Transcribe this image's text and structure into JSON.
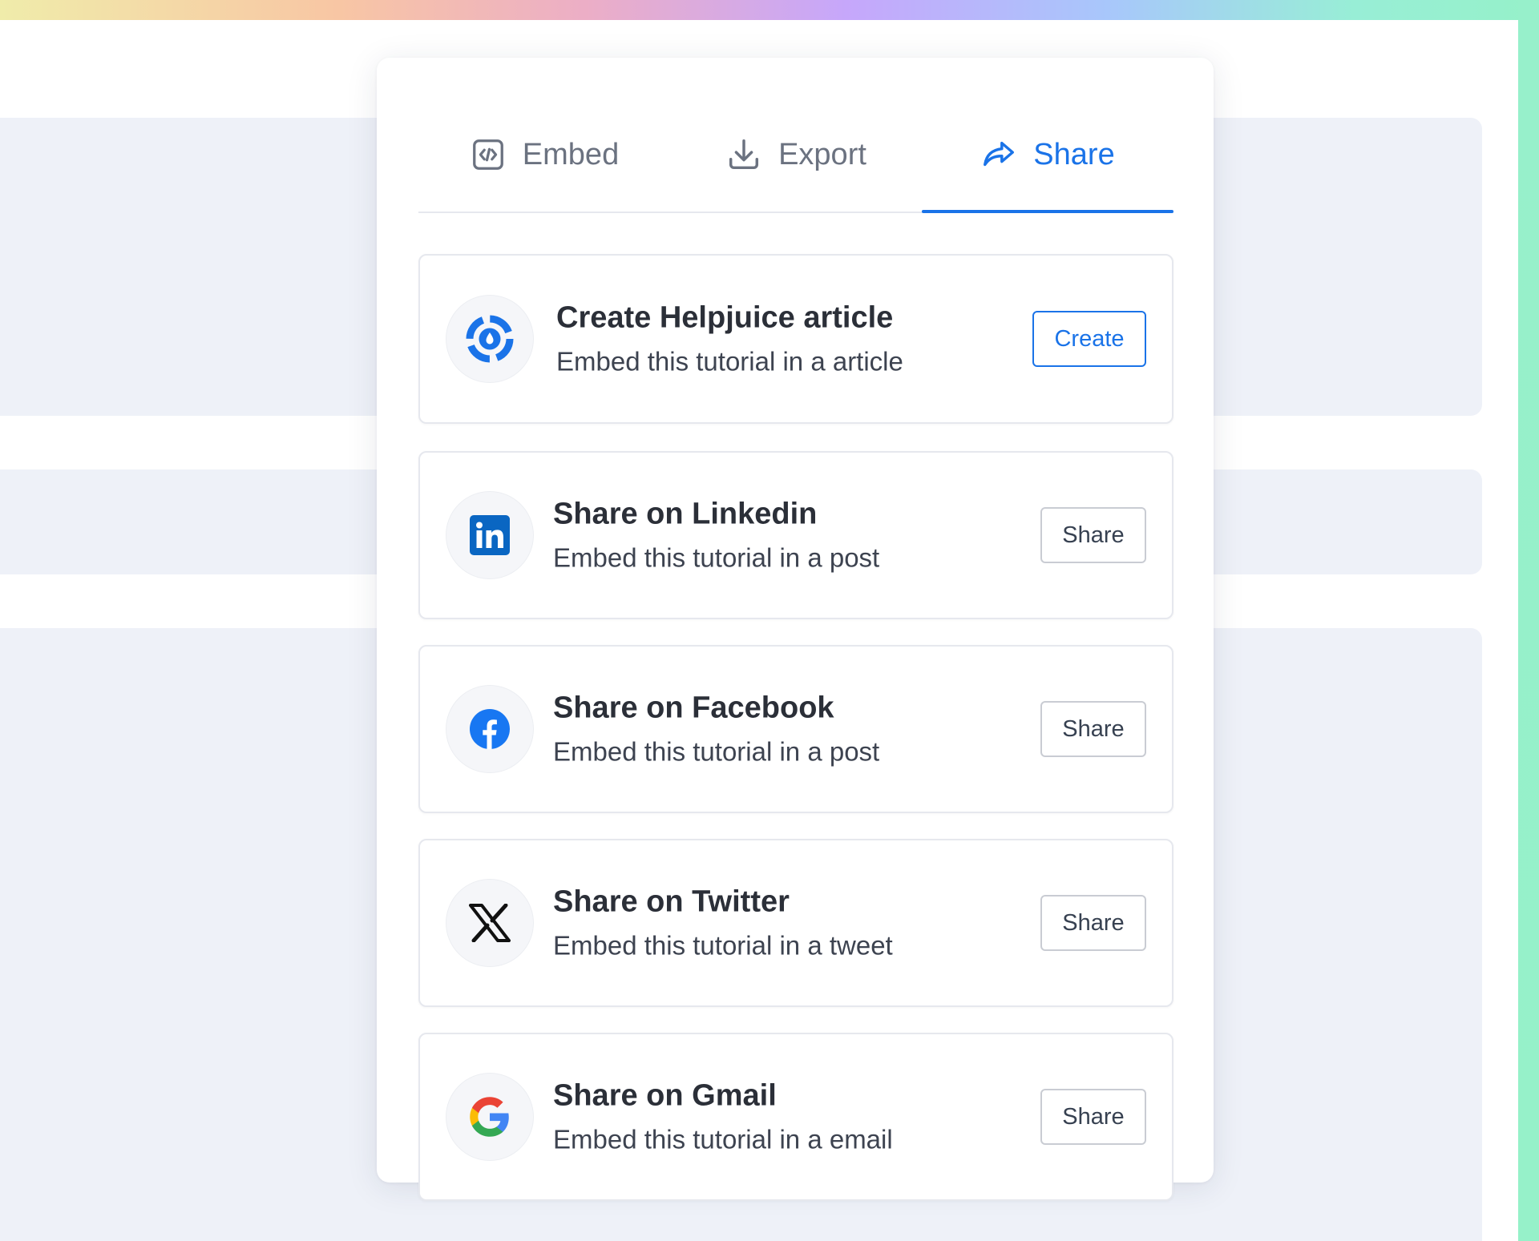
{
  "colors": {
    "accent": "#1a73e8",
    "linkedin": "#0a66c2",
    "facebook": "#1877f2",
    "helpjuice": "#1a73e8"
  },
  "tabs": [
    {
      "label": "Embed",
      "icon": "code-embed-icon",
      "active": false
    },
    {
      "label": "Export",
      "icon": "download-icon",
      "active": false
    },
    {
      "label": "Share",
      "icon": "share-forward-icon",
      "active": true
    }
  ],
  "items": [
    {
      "title": "Create Helpjuice article",
      "subtitle": "Embed this tutorial in a article",
      "button": "Create",
      "icon": "helpjuice-logo-icon"
    },
    {
      "title": "Share on Linkedin",
      "subtitle": "Embed this tutorial in a post",
      "button": "Share",
      "icon": "linkedin-logo-icon"
    },
    {
      "title": "Share on Facebook",
      "subtitle": "Embed this tutorial in a post",
      "button": "Share",
      "icon": "facebook-logo-icon"
    },
    {
      "title": "Share on Twitter",
      "subtitle": "Embed this tutorial in a tweet",
      "button": "Share",
      "icon": "x-logo-icon"
    },
    {
      "title": "Share on Gmail",
      "subtitle": "Embed this tutorial in a email",
      "button": "Share",
      "icon": "google-logo-icon"
    }
  ]
}
